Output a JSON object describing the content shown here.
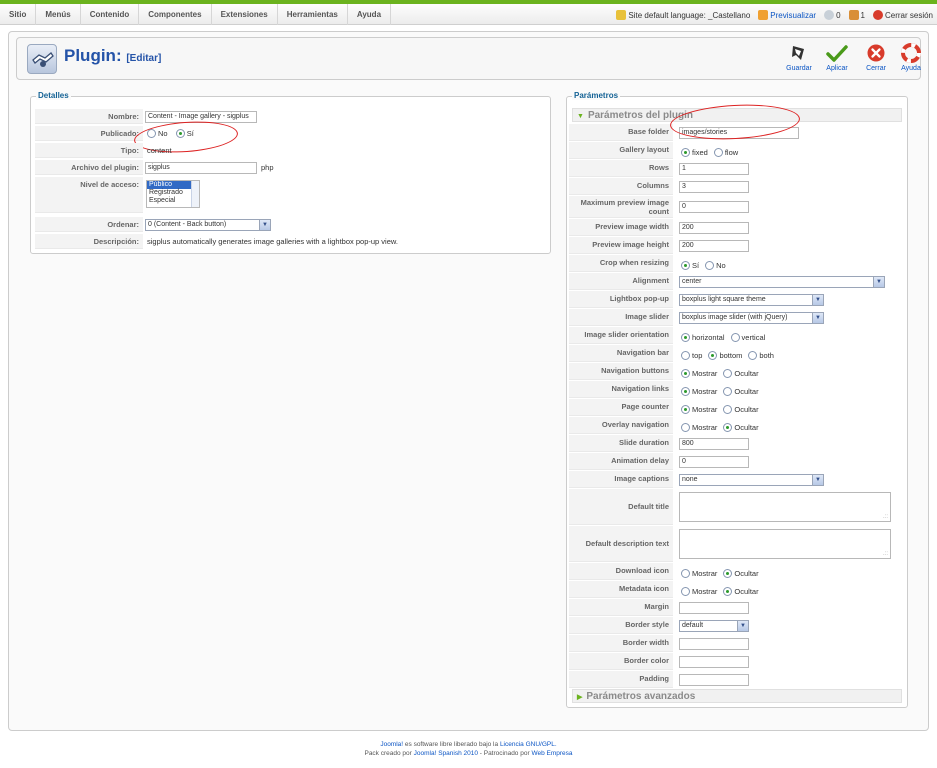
{
  "menu": [
    "Sitio",
    "Menús",
    "Contenido",
    "Componentes",
    "Extensiones",
    "Herramientas",
    "Ayuda"
  ],
  "status": {
    "language": "Site default language: _Castellano",
    "preview": "Previsualizar",
    "messages": "0",
    "users": "1",
    "logout": "Cerrar sesión"
  },
  "header": {
    "title": "Plugin:",
    "subtitle": "[Editar]"
  },
  "toolbar": {
    "save": "Guardar",
    "apply": "Aplicar",
    "close": "Cerrar",
    "help": "Ayuda"
  },
  "details": {
    "legend": "Detalles",
    "name_label": "Nombre:",
    "name_value": "Content - Image gallery - sigplus",
    "published_label": "Publicado:",
    "no": "No",
    "yes": "Sí",
    "type_label": "Tipo:",
    "type_value": "content",
    "file_label": "Archivo del plugin:",
    "file_value": "sigplus",
    "file_ext": "php",
    "access_label": "Nivel de acceso:",
    "access_options": [
      "Público",
      "Registrado",
      "Especial"
    ],
    "order_label": "Ordenar:",
    "order_value": "0 (Content - Back button)",
    "desc_label": "Descripción:",
    "desc_value": "sigplus automatically generates image galleries with a lightbox pop-up view."
  },
  "params": {
    "legend": "Parámetros",
    "section_title": "Parámetros del plugin",
    "advanced_title": "Parámetros avanzados",
    "show": "Mostrar",
    "hide": "Ocultar",
    "rows": [
      {
        "label": "Base folder",
        "value": "images/stories"
      },
      {
        "label": "Gallery layout",
        "opt1": "fixed",
        "opt2": "flow"
      },
      {
        "label": "Rows",
        "value": "1"
      },
      {
        "label": "Columns",
        "value": "3"
      },
      {
        "label": "Maximum preview image count",
        "value": "0"
      },
      {
        "label": "Preview image width",
        "value": "200"
      },
      {
        "label": "Preview image height",
        "value": "200"
      },
      {
        "label": "Crop when resizing",
        "opt1": "Sí",
        "opt2": "No"
      },
      {
        "label": "Alignment",
        "value": "center"
      },
      {
        "label": "Lightbox pop-up",
        "value": "boxplus light square theme"
      },
      {
        "label": "Image slider",
        "value": "boxplus image slider (with jQuery)"
      },
      {
        "label": "Image slider orientation",
        "opt1": "horizontal",
        "opt2": "vertical"
      },
      {
        "label": "Navigation bar",
        "opt1": "top",
        "opt2": "bottom",
        "opt3": "both"
      },
      {
        "label": "Navigation buttons"
      },
      {
        "label": "Navigation links"
      },
      {
        "label": "Page counter"
      },
      {
        "label": "Overlay navigation"
      },
      {
        "label": "Slide duration",
        "value": "800"
      },
      {
        "label": "Animation delay",
        "value": "0"
      },
      {
        "label": "Image captions",
        "value": "none"
      },
      {
        "label": "Default title",
        "value": ""
      },
      {
        "label": "Default description text",
        "value": ""
      },
      {
        "label": "Download icon"
      },
      {
        "label": "Metadata icon"
      },
      {
        "label": "Margin",
        "value": ""
      },
      {
        "label": "Border style",
        "value": "default"
      },
      {
        "label": "Border width",
        "value": ""
      },
      {
        "label": "Border color",
        "value": ""
      },
      {
        "label": "Padding",
        "value": ""
      }
    ]
  },
  "footer": {
    "line1_link": "Joomla!",
    "line1_mid": " es software libre liberado bajo la ",
    "line1_link2": "Licencia GNU/GPL.",
    "line2_pre": "Pack creado por ",
    "line2_link1": "Joomla! Spanish 2010",
    "line2_mid": " - Patrocinado por ",
    "line2_link2": "Web Empresa"
  },
  "colors": {
    "accent": "#6bb31e",
    "link": "#0b55c4",
    "legend": "#146295",
    "annotation": "#dd2222"
  }
}
